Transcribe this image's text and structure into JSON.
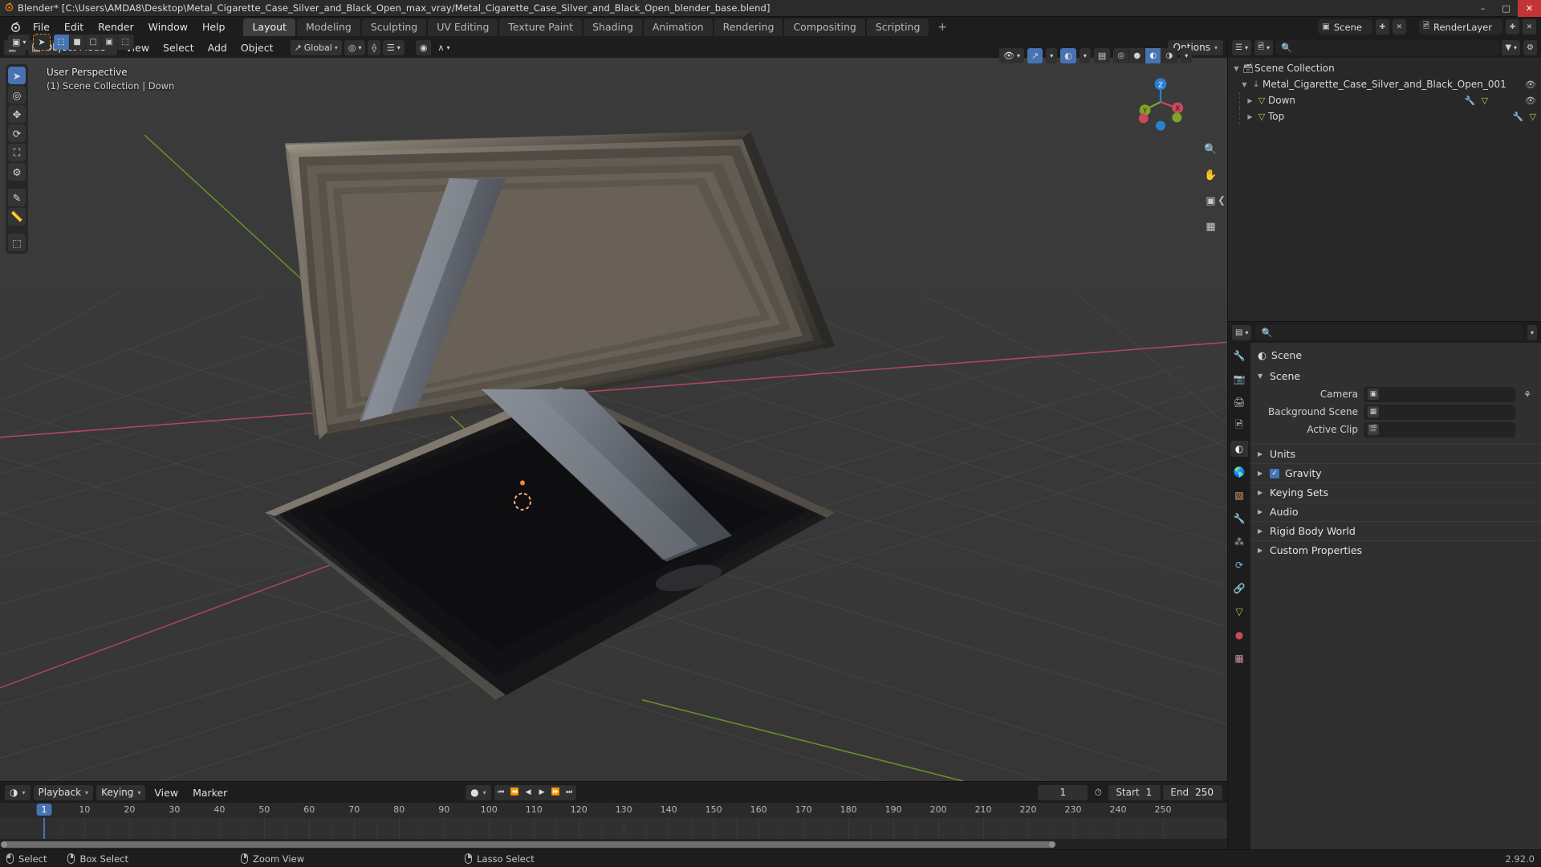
{
  "window": {
    "title": "Blender* [C:\\Users\\AMDA8\\Desktop\\Metal_Cigarette_Case_Silver_and_Black_Open_max_vray/Metal_Cigarette_Case_Silver_and_Black_Open_blender_base.blend]",
    "app_icon": "blender-logo-icon",
    "minimize": "–",
    "maximize": "□",
    "close": "✕"
  },
  "menubar": {
    "items": [
      {
        "label": "File"
      },
      {
        "label": "Edit"
      },
      {
        "label": "Render"
      },
      {
        "label": "Window"
      },
      {
        "label": "Help"
      }
    ],
    "workspace_tabs": [
      {
        "label": "Layout",
        "active": true
      },
      {
        "label": "Modeling",
        "active": false
      },
      {
        "label": "Sculpting",
        "active": false
      },
      {
        "label": "UV Editing",
        "active": false
      },
      {
        "label": "Texture Paint",
        "active": false
      },
      {
        "label": "Shading",
        "active": false
      },
      {
        "label": "Animation",
        "active": false
      },
      {
        "label": "Rendering",
        "active": false
      },
      {
        "label": "Compositing",
        "active": false
      },
      {
        "label": "Scripting",
        "active": false
      }
    ],
    "add_workspace": "+",
    "scene_name": "Scene",
    "viewlayer_name": "RenderLayer"
  },
  "viewport": {
    "mode": "Object Mode",
    "menus": [
      {
        "label": "View"
      },
      {
        "label": "Select"
      },
      {
        "label": "Add"
      },
      {
        "label": "Object"
      }
    ],
    "transform_orientation": "Global",
    "options_label": "Options",
    "hud_perspective": "User Perspective",
    "hud_collection": "(1) Scene Collection | Down",
    "gizmo_axes": {
      "x": "X",
      "y": "Y",
      "z": "Z"
    },
    "tools": [
      {
        "name": "tweak-tool",
        "glyph": "➤",
        "active": true
      },
      {
        "name": "cursor-tool",
        "glyph": "⌖",
        "active": false
      },
      {
        "name": "move-tool",
        "glyph": "✥",
        "active": false
      },
      {
        "name": "rotate-tool",
        "glyph": "↻",
        "active": false
      },
      {
        "name": "scale-tool",
        "glyph": "◱",
        "active": false
      },
      {
        "name": "transform-tool",
        "glyph": "⬡",
        "active": false
      },
      {
        "name": "annotate-tool",
        "glyph": "✎",
        "active": false
      },
      {
        "name": "measure-tool",
        "glyph": "↗",
        "active": false
      },
      {
        "name": "add-cube-tool",
        "glyph": "⬚",
        "active": false
      }
    ],
    "nav_buttons": [
      {
        "name": "zoom-view-icon",
        "glyph": "⌕"
      },
      {
        "name": "pan-view-icon",
        "glyph": "✋"
      },
      {
        "name": "camera-view-icon",
        "glyph": "▣"
      },
      {
        "name": "toggle-ortho-icon",
        "glyph": "▦"
      }
    ],
    "select_modes": [
      {
        "name": "select-box",
        "glyph": "⬚",
        "active": true
      },
      {
        "name": "select-extend",
        "glyph": "■",
        "active": false
      },
      {
        "name": "select-subtract",
        "glyph": "□",
        "active": false
      },
      {
        "name": "select-invert",
        "glyph": "▣",
        "active": false
      },
      {
        "name": "select-intersect",
        "glyph": "⬚",
        "active": false
      }
    ],
    "shading_modes": [
      {
        "name": "wireframe-shading",
        "glyph": "⬤",
        "active": false
      },
      {
        "name": "solid-shading",
        "glyph": "⬤",
        "active": false
      },
      {
        "name": "material-preview-shading",
        "glyph": "◔",
        "active": true
      },
      {
        "name": "rendered-shading",
        "glyph": "◑",
        "active": false
      }
    ]
  },
  "outliner": {
    "display_mode": "view-layer-icon",
    "search_placeholder": "",
    "rows": [
      {
        "indent": 0,
        "triangle": "▼",
        "icon": "🗃",
        "label": "Scene Collection",
        "visible_icon": "",
        "has_eye": false
      },
      {
        "indent": 1,
        "triangle": "▼",
        "icon": "⎇",
        "label": "Metal_Cigarette_Case_Silver_and_Black_Open_001",
        "has_eye": true
      },
      {
        "indent": 2,
        "triangle": "▶",
        "icon": "▽",
        "label": "Down",
        "has_eye": true,
        "extra_icons": [
          "🔗",
          "▽"
        ]
      },
      {
        "indent": 2,
        "triangle": "▶",
        "icon": "▽",
        "label": "Top",
        "has_eye": false,
        "extra_icons": [
          "🔗",
          "▽"
        ]
      }
    ]
  },
  "properties": {
    "breadcrumb_icon": "scene-properties-icon",
    "breadcrumb_label": "Scene",
    "panel_title": "Scene",
    "search_placeholder": "",
    "tabs": [
      {
        "name": "tool-tab",
        "glyph": "🔧",
        "active": false
      },
      {
        "name": "render-tab",
        "glyph": "📷",
        "active": false
      },
      {
        "name": "output-tab",
        "glyph": "🖨",
        "active": false
      },
      {
        "name": "view-layer-tab",
        "glyph": "🖼",
        "active": false
      },
      {
        "name": "scene-tab",
        "glyph": "◔",
        "active": true
      },
      {
        "name": "world-tab",
        "glyph": "🌍",
        "active": false
      },
      {
        "name": "object-tab",
        "glyph": "▧",
        "active": false
      },
      {
        "name": "modifier-tab",
        "glyph": "🔧",
        "active": false
      },
      {
        "name": "particles-tab",
        "glyph": "⁂",
        "active": false
      },
      {
        "name": "physics-tab",
        "glyph": "⟳",
        "active": false
      },
      {
        "name": "constraints-tab",
        "glyph": "🔗",
        "active": false
      },
      {
        "name": "data-tab",
        "glyph": "▽",
        "active": false
      },
      {
        "name": "material-tab",
        "glyph": "●",
        "active": false
      },
      {
        "name": "texture-tab",
        "glyph": "▒",
        "active": false
      }
    ],
    "rows": [
      {
        "label": "Camera",
        "value": "",
        "field_icon": "camera-icon",
        "eyedropper": true
      },
      {
        "label": "Background Scene",
        "value": "",
        "field_icon": "scene-icon",
        "eyedropper": false
      },
      {
        "label": "Active Clip",
        "value": "",
        "field_icon": "clip-icon",
        "eyedropper": false
      }
    ],
    "sections": [
      {
        "label": "Units",
        "expanded": false,
        "checkbox": null
      },
      {
        "label": "Gravity",
        "expanded": false,
        "checkbox": true
      },
      {
        "label": "Keying Sets",
        "expanded": false,
        "checkbox": null
      },
      {
        "label": "Audio",
        "expanded": false,
        "checkbox": null
      },
      {
        "label": "Rigid Body World",
        "expanded": false,
        "checkbox": null
      },
      {
        "label": "Custom Properties",
        "expanded": false,
        "checkbox": null
      }
    ]
  },
  "timeline": {
    "editor_icon": "timeline-icon",
    "menus": [
      {
        "label": "Playback",
        "dropdown": true
      },
      {
        "label": "Keying",
        "dropdown": true
      },
      {
        "label": "View",
        "dropdown": false
      },
      {
        "label": "Marker",
        "dropdown": false
      }
    ],
    "transport": [
      {
        "name": "jump-to-start-button",
        "glyph": "⏮"
      },
      {
        "name": "previous-keyframe-button",
        "glyph": "⏪"
      },
      {
        "name": "play-reverse-button",
        "glyph": "◀"
      },
      {
        "name": "play-button",
        "glyph": "▶"
      },
      {
        "name": "next-keyframe-button",
        "glyph": "⏩"
      },
      {
        "name": "jump-to-end-button",
        "glyph": "⏭"
      }
    ],
    "current_frame": "1",
    "start_label": "Start",
    "start_value": "1",
    "end_label": "End",
    "end_value": "250",
    "ticks": [
      "10",
      "20",
      "30",
      "40",
      "50",
      "60",
      "70",
      "80",
      "90",
      "100",
      "110",
      "120",
      "130",
      "140",
      "150",
      "160",
      "170",
      "180",
      "190",
      "200",
      "210",
      "220",
      "230",
      "240",
      "250"
    ],
    "playhead_label": "1"
  },
  "statusbar": {
    "items": [
      {
        "mouse": "l",
        "label": "Select"
      },
      {
        "mouse": "m",
        "label": "Box Select"
      },
      {
        "mouse": "m2",
        "label": "Zoom View"
      },
      {
        "mouse": "r",
        "label": "Lasso Select"
      }
    ],
    "version": "2.92.0"
  },
  "colors": {
    "accent_blue": "#4772b3",
    "axis_x_red": "#c9485b",
    "axis_y_green": "#7ba428",
    "axis_z_blue": "#2b7fd4",
    "panel_bg": "#303030",
    "header_bg": "#1d1d1d",
    "viewport_bg": "#393939",
    "cursor_orange": "#e88a3c"
  }
}
